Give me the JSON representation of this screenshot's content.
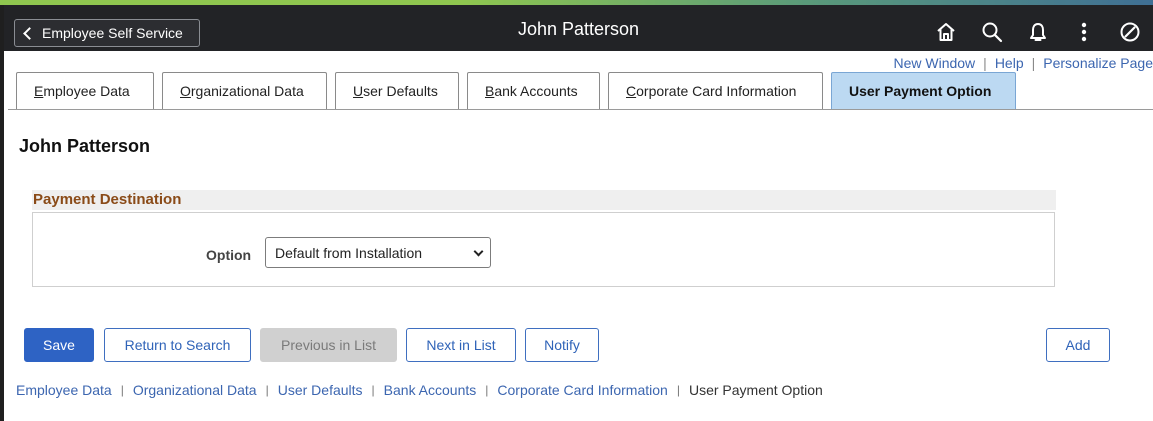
{
  "header": {
    "back_label": "Employee Self Service",
    "title": "John Patterson",
    "icons": [
      "home-icon",
      "search-icon",
      "bell-icon",
      "more-vertical-icon",
      "compass-icon"
    ]
  },
  "util_links": {
    "new_window": "New Window",
    "help": "Help",
    "personalize": "Personalize Page",
    "separator": "|"
  },
  "tabs": [
    {
      "label_u": "E",
      "label_rest": "mployee Data"
    },
    {
      "label_u": "O",
      "label_rest": "rganizational Data"
    },
    {
      "label_u": "U",
      "label_rest": "ser Defaults"
    },
    {
      "label_u": "B",
      "label_rest": "ank Accounts"
    },
    {
      "label_u": "C",
      "label_rest": "orporate Card Information"
    },
    {
      "label": "User Payment Option",
      "active": true
    }
  ],
  "main": {
    "person_name": "John Patterson",
    "group_title": "Payment Destination",
    "option_label": "Option",
    "option_value": "Default from Installation"
  },
  "buttons": {
    "save": "Save",
    "return_to_search": "Return to Search",
    "previous_in_list": "Previous in List",
    "next_in_list": "Next in List",
    "notify": "Notify",
    "add": "Add"
  },
  "bottom_links": [
    "Employee Data",
    "Organizational Data",
    "User Defaults",
    "Bank Accounts",
    "Corporate Card Information",
    "User Payment Option"
  ],
  "colors": {
    "header_bg": "#222326",
    "active_tab": "#bcd9f2",
    "primary_button": "#2e63c4",
    "group_title": "#8a4b18",
    "link": "#3c66b0"
  }
}
